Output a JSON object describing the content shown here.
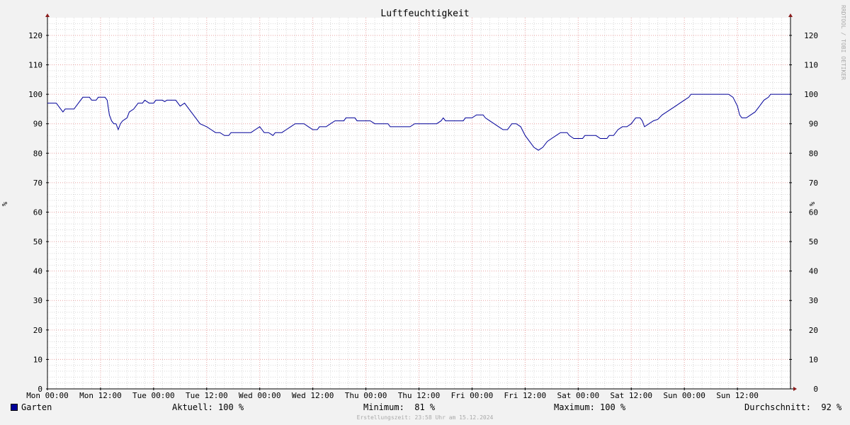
{
  "colors": {
    "background": "#f2f2f2",
    "plot_background": "#ffffff",
    "series": "#000099",
    "minor_grid": "#d8d8d8",
    "major_grid": "#e8a0a0",
    "axis": "#000000",
    "arrow": "#8b1a1a"
  },
  "watermark": "RRDTOOL / TOBI OETIKER",
  "footer_note": "Erstellungszeit: 23:58 Uhr am 15.12.2024",
  "legend": {
    "series_name": "Garten",
    "current": "Aktuell: 100 %",
    "minimum": "Minimum:  81 %",
    "maximum": "Maximum: 100 %",
    "average": "Durchschnitt:  92 %"
  },
  "chart_data": {
    "type": "line",
    "title": "Luftfeuchtigkeit",
    "ylabel_left": "%",
    "ylabel_right": "%",
    "ylim": [
      0,
      126
    ],
    "y_ticks": [
      0,
      10,
      20,
      30,
      40,
      50,
      60,
      70,
      80,
      90,
      100,
      110,
      120
    ],
    "xlim_hours": [
      0,
      168
    ],
    "x_ticks": [
      {
        "hour": 0,
        "label": "Mon 00:00"
      },
      {
        "hour": 12,
        "label": "Mon 12:00"
      },
      {
        "hour": 24,
        "label": "Tue 00:00"
      },
      {
        "hour": 36,
        "label": "Tue 12:00"
      },
      {
        "hour": 48,
        "label": "Wed 00:00"
      },
      {
        "hour": 60,
        "label": "Wed 12:00"
      },
      {
        "hour": 72,
        "label": "Thu 00:00"
      },
      {
        "hour": 84,
        "label": "Thu 12:00"
      },
      {
        "hour": 96,
        "label": "Fri 00:00"
      },
      {
        "hour": 108,
        "label": "Fri 12:00"
      },
      {
        "hour": 120,
        "label": "Sat 00:00"
      },
      {
        "hour": 132,
        "label": "Sat 12:00"
      },
      {
        "hour": 144,
        "label": "Sun 00:00"
      },
      {
        "hour": 156,
        "label": "Sun 12:00"
      }
    ],
    "grid": true,
    "series": [
      {
        "name": "Garten",
        "points": [
          [
            0,
            97
          ],
          [
            2,
            97
          ],
          [
            2.5,
            96
          ],
          [
            3,
            95
          ],
          [
            3.5,
            94
          ],
          [
            4,
            95
          ],
          [
            6,
            95
          ],
          [
            7,
            97
          ],
          [
            8,
            99
          ],
          [
            9.5,
            99
          ],
          [
            10,
            98
          ],
          [
            11,
            98
          ],
          [
            11.5,
            99
          ],
          [
            13,
            99
          ],
          [
            13.5,
            98
          ],
          [
            14,
            93
          ],
          [
            14.5,
            91
          ],
          [
            15,
            90
          ],
          [
            15.5,
            90
          ],
          [
            16,
            88
          ],
          [
            16.5,
            90
          ],
          [
            17,
            91
          ],
          [
            18,
            92
          ],
          [
            18.5,
            94
          ],
          [
            19.5,
            95
          ],
          [
            20.5,
            97
          ],
          [
            21.5,
            97
          ],
          [
            22,
            98
          ],
          [
            23,
            97
          ],
          [
            24,
            97
          ],
          [
            24.5,
            98
          ],
          [
            26,
            98
          ],
          [
            26.5,
            97.5
          ],
          [
            27,
            98
          ],
          [
            29,
            98
          ],
          [
            29.5,
            97
          ],
          [
            30,
            96
          ],
          [
            31,
            97
          ],
          [
            31.5,
            96
          ],
          [
            32.5,
            94
          ],
          [
            33.5,
            92
          ],
          [
            34.5,
            90
          ],
          [
            36,
            89
          ],
          [
            37,
            88
          ],
          [
            38,
            87
          ],
          [
            39,
            87
          ],
          [
            40,
            86
          ],
          [
            41,
            86
          ],
          [
            41.5,
            87
          ],
          [
            46,
            87
          ],
          [
            47,
            88
          ],
          [
            48,
            89
          ],
          [
            48.5,
            88
          ],
          [
            49,
            87
          ],
          [
            50,
            87
          ],
          [
            51,
            86
          ],
          [
            51.5,
            87
          ],
          [
            53,
            87
          ],
          [
            54,
            88
          ],
          [
            55,
            89
          ],
          [
            56,
            90
          ],
          [
            58,
            90
          ],
          [
            59,
            89
          ],
          [
            60,
            88
          ],
          [
            61,
            88
          ],
          [
            61.5,
            89
          ],
          [
            63,
            89
          ],
          [
            64,
            90
          ],
          [
            65,
            91
          ],
          [
            67,
            91
          ],
          [
            67.5,
            92
          ],
          [
            69.5,
            92
          ],
          [
            70,
            91
          ],
          [
            73,
            91
          ],
          [
            74,
            90
          ],
          [
            77,
            90
          ],
          [
            77.5,
            89
          ],
          [
            82,
            89
          ],
          [
            83,
            90
          ],
          [
            88,
            90
          ],
          [
            89,
            91
          ],
          [
            89.5,
            92
          ],
          [
            90,
            91
          ],
          [
            94,
            91
          ],
          [
            94.5,
            92
          ],
          [
            96,
            92
          ],
          [
            97,
            93
          ],
          [
            98.5,
            93
          ],
          [
            99,
            92
          ],
          [
            100,
            91
          ],
          [
            101,
            90
          ],
          [
            102,
            89
          ],
          [
            103,
            88
          ],
          [
            104,
            88
          ],
          [
            105,
            90
          ],
          [
            106,
            90
          ],
          [
            107,
            89
          ],
          [
            108,
            86
          ],
          [
            109,
            84
          ],
          [
            110,
            82
          ],
          [
            111,
            81
          ],
          [
            112,
            82
          ],
          [
            113,
            84
          ],
          [
            114,
            85
          ],
          [
            115,
            86
          ],
          [
            116,
            87
          ],
          [
            117.5,
            87
          ],
          [
            118,
            86
          ],
          [
            119,
            85
          ],
          [
            121,
            85
          ],
          [
            121.5,
            86
          ],
          [
            124,
            86
          ],
          [
            125,
            85
          ],
          [
            126.5,
            85
          ],
          [
            127,
            86
          ],
          [
            128,
            86
          ],
          [
            129,
            88
          ],
          [
            130,
            89
          ],
          [
            131,
            89
          ],
          [
            132,
            90
          ],
          [
            132.5,
            91
          ],
          [
            133,
            92
          ],
          [
            134,
            92
          ],
          [
            134.5,
            91
          ],
          [
            135,
            89
          ],
          [
            136,
            90
          ],
          [
            137,
            91
          ],
          [
            138,
            91.5
          ],
          [
            139,
            93
          ],
          [
            140,
            94
          ],
          [
            141,
            95
          ],
          [
            142,
            96
          ],
          [
            143,
            97
          ],
          [
            144,
            98
          ],
          [
            145,
            99
          ],
          [
            145.5,
            100
          ],
          [
            154,
            100
          ],
          [
            155,
            99
          ],
          [
            156,
            96
          ],
          [
            156.5,
            93
          ],
          [
            157,
            92
          ],
          [
            158,
            92
          ],
          [
            159,
            93
          ],
          [
            160,
            94
          ],
          [
            161,
            96
          ],
          [
            162,
            98
          ],
          [
            163,
            99
          ],
          [
            163.5,
            100
          ],
          [
            168,
            100
          ]
        ]
      }
    ]
  }
}
